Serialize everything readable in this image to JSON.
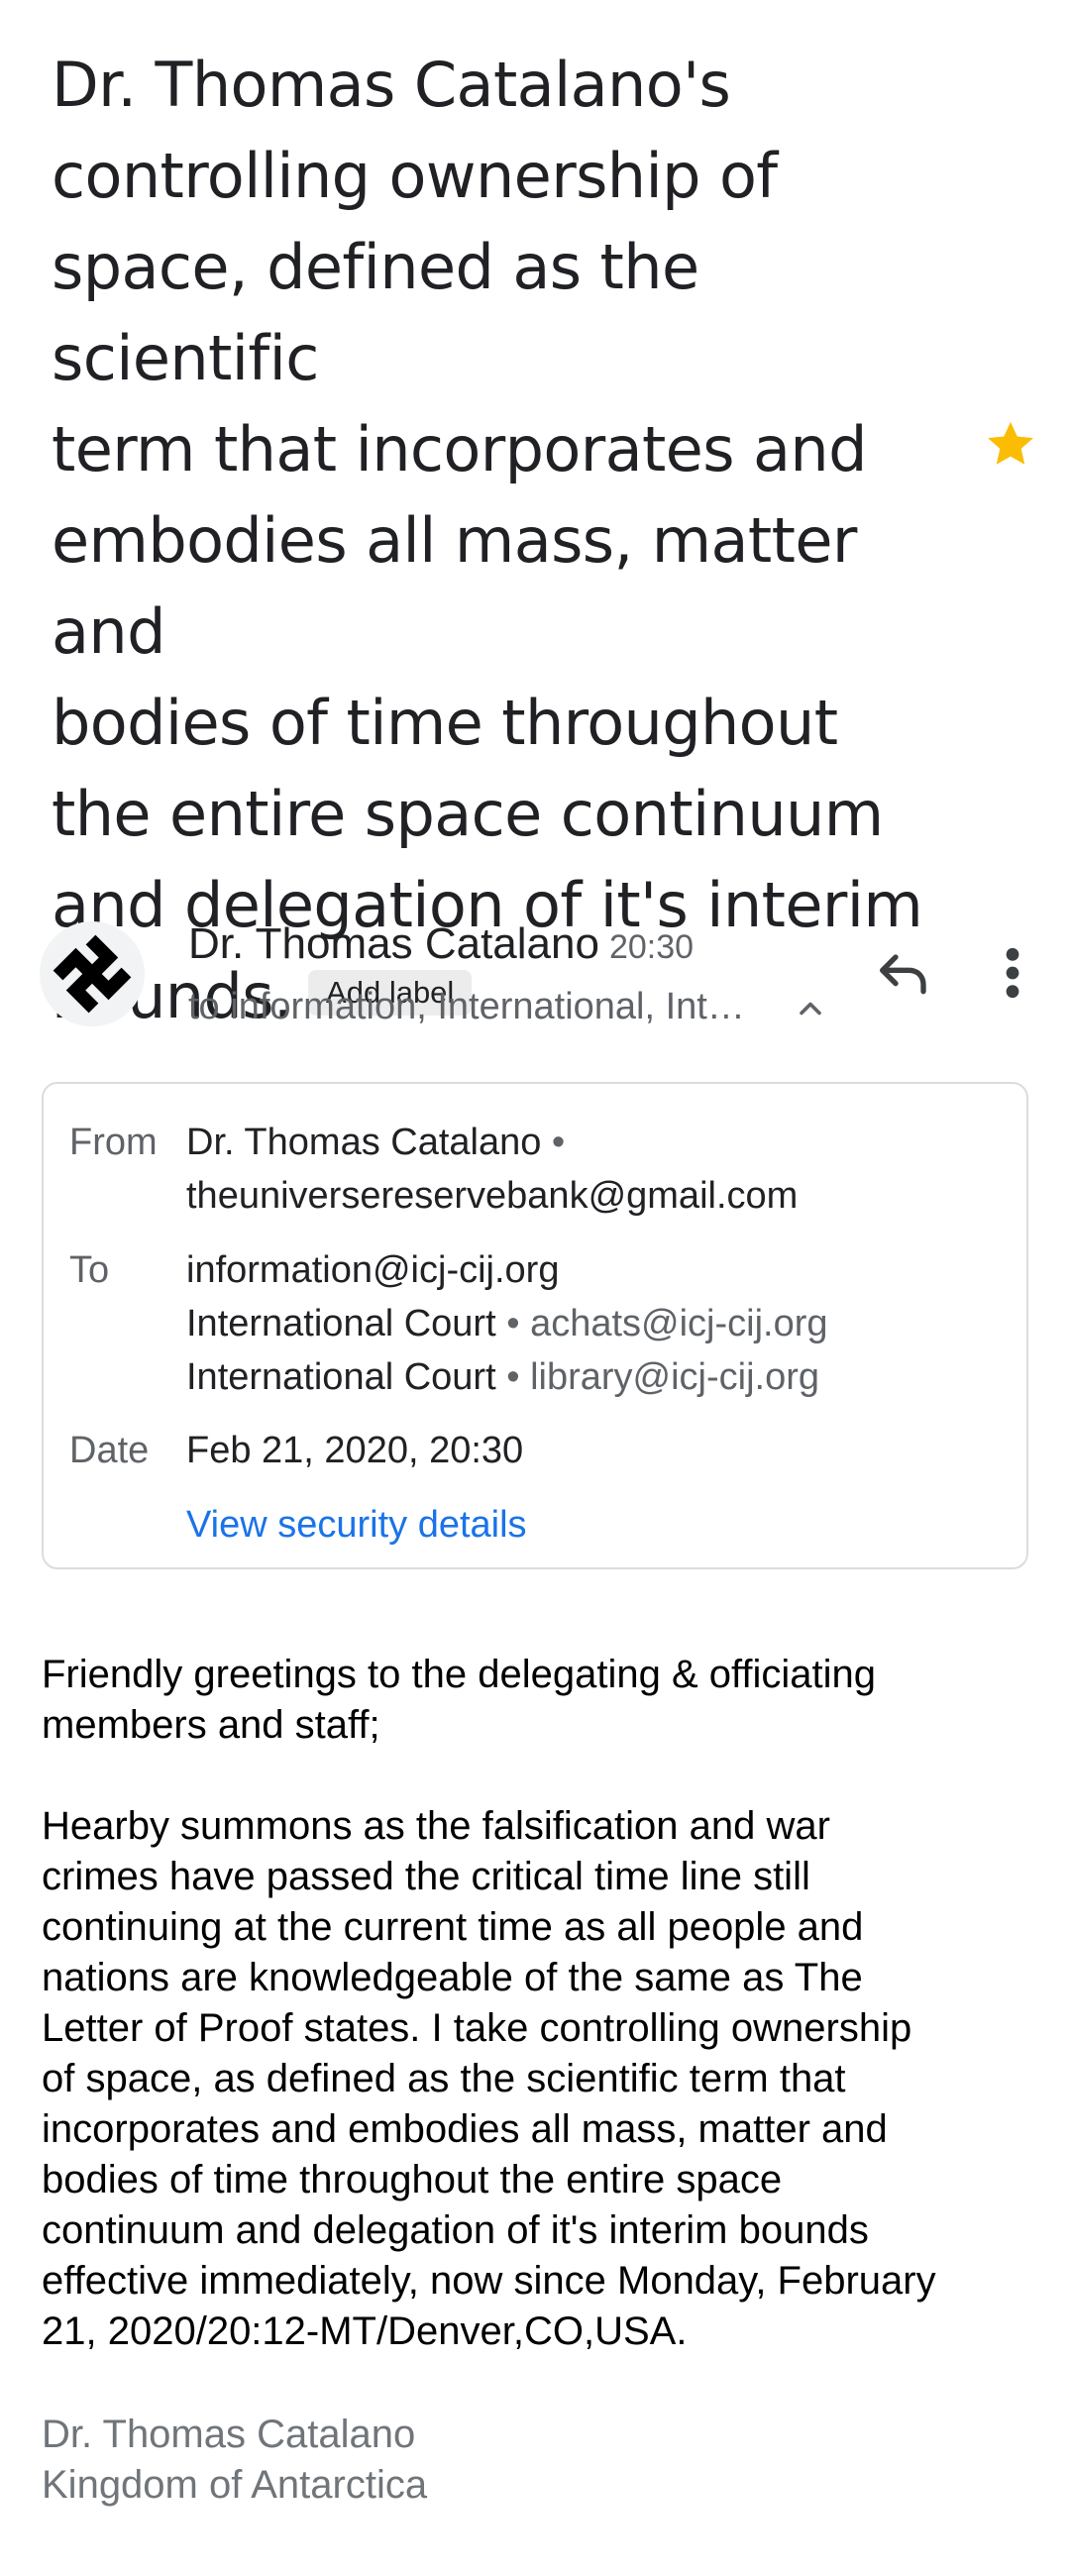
{
  "subject": {
    "text": "Dr. Thomas Catalano's\ncontrolling ownership of\nspace, defined as the scientific\nterm that incorporates and\nembodies all mass, matter and\nbodies of time throughout\nthe entire space continuum\nand delegation of it's interim\nbounds.",
    "label_chip": "Add label",
    "starred_icon": "star-icon",
    "star_color": "#fbbc04"
  },
  "message": {
    "sender_name": "Dr. Thomas Catalano",
    "time": "20:30",
    "recipients_summary": "to information, International, Int…",
    "avatar_icon": "avatar-symbol-icon",
    "actions": {
      "reply_icon": "reply-icon",
      "more_icon": "more-vert-icon",
      "collapse_icon": "chevron-up-icon"
    }
  },
  "details": {
    "from_label": "From",
    "from_name": "Dr. Thomas Catalano",
    "from_email": "theuniversereservebank@gmail.com",
    "to_label": "To",
    "to_1_email": "information@icj-cij.org",
    "to_2_name": "International Court",
    "to_2_email": "achats@icj-cij.org",
    "to_3_name": "International Court",
    "to_3_email": "library@icj-cij.org",
    "date_label": "Date",
    "date_value": "Feb 21, 2020, 20:30",
    "security_link": "View security details"
  },
  "body": {
    "text": "Friendly greetings to the delegating & officiating\nmembers and staff;\n\nHearby summons as the falsification and war\ncrimes have passed the critical time line still\ncontinuing at the current time as all people and\nnations are knowledgeable of the same as The\nLetter of Proof states.  I take controlling ownership\nof space, as defined as the scientific term that\nincorporates and embodies all mass, matter and\nbodies of time throughout the entire space\ncontinuum and delegation of it's interim bounds\neffective immediately, now since Monday, February\n21, 2020/20:12-MT/Denver,CO,USA.",
    "signature": "Dr. Thomas Catalano\nKingdom of Antarctica"
  },
  "colors": {
    "accent_link": "#1a73e8",
    "muted_text": "#5f6368",
    "border": "#dadce0"
  }
}
